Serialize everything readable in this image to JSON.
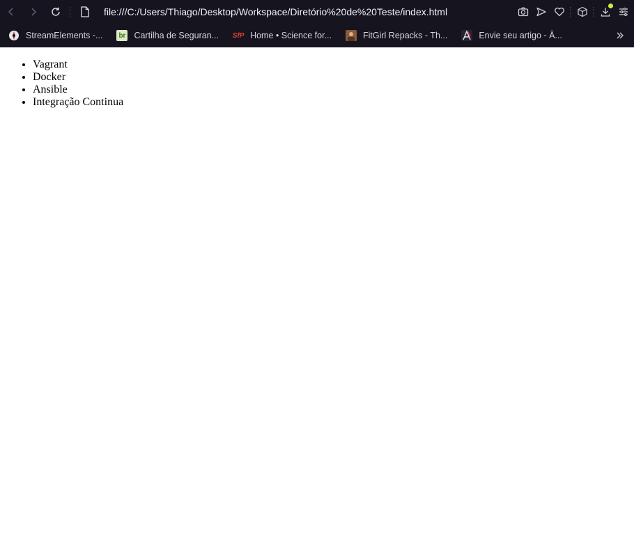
{
  "browser": {
    "address": "file:///C:/Users/Thiago/Desktop/Workspace/Diretório%20de%20Teste/index.html",
    "bookmarks": [
      {
        "label": "StreamElements -...",
        "favicon": "streamelements-icon"
      },
      {
        "label": "Cartilha de Seguran...",
        "favicon": "cartilha-icon"
      },
      {
        "label": "Home • Science for...",
        "favicon": "science-icon"
      },
      {
        "label": "FitGirl Repacks - Th...",
        "favicon": "fitgirl-icon"
      },
      {
        "label": "Envie seu artigo - Â...",
        "favicon": "artigo-icon"
      }
    ],
    "icons": [
      "back-icon",
      "forward-icon",
      "reload-icon",
      "page-icon",
      "camera-icon",
      "send-icon",
      "heart-icon",
      "cube-icon",
      "download-icon",
      "menu-icon",
      "more-bookmarks-icon"
    ],
    "download_badge_color": "#c8f04a"
  },
  "page": {
    "list": [
      "Vagrant",
      "Docker",
      "Ansible",
      "Integração Continua"
    ]
  }
}
